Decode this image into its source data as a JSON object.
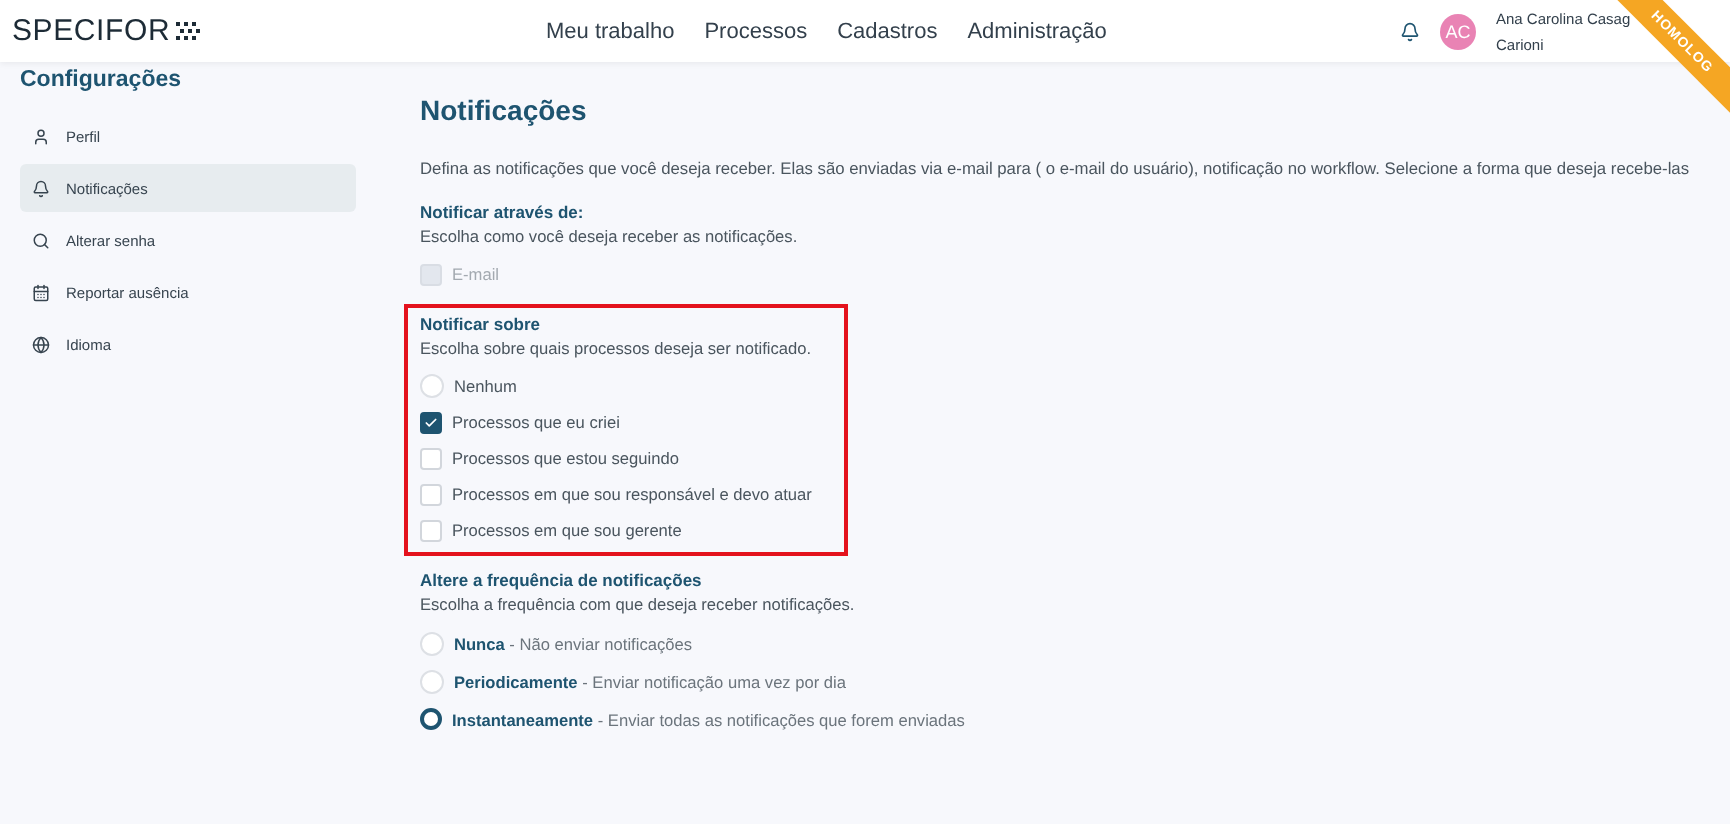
{
  "header": {
    "logo": "SPECIFOR",
    "nav": [
      "Meu trabalho",
      "Processos",
      "Cadastros",
      "Administração"
    ],
    "user": {
      "initials": "AC",
      "name_line1": "Ana Carolina Casag",
      "name_line2": "Carioni"
    },
    "ribbon": "HOMOLOG"
  },
  "sidebar": {
    "title": "Configurações",
    "items": [
      {
        "label": "Perfil",
        "selected": false
      },
      {
        "label": "Notificações",
        "selected": true
      },
      {
        "label": "Alterar senha",
        "selected": false
      },
      {
        "label": "Reportar ausência",
        "selected": false
      },
      {
        "label": "Idioma",
        "selected": false
      }
    ]
  },
  "page": {
    "title": "Notificações",
    "description": "Defina as notificações que você deseja receber. Elas são enviadas via e-mail para ( o e-mail do usuário), notificação no workflow. Selecione a forma que deseja recebe-las",
    "sections": [
      {
        "title": "Notificar através de:",
        "subtitle": "Escolha como você deseja receber as notificações.",
        "highlighted": false,
        "options": [
          {
            "kind": "checkbox",
            "label": "E-mail",
            "checked": false,
            "disabled": true
          }
        ]
      },
      {
        "title": "Notificar sobre",
        "subtitle": "Escolha sobre quais processos deseja ser notificado.",
        "highlighted": true,
        "options": [
          {
            "kind": "radio",
            "label": "Nenhum",
            "checked": false
          },
          {
            "kind": "checkbox",
            "label": "Processos que eu criei",
            "checked": true
          },
          {
            "kind": "checkbox",
            "label": "Processos que estou seguindo",
            "checked": false
          },
          {
            "kind": "checkbox",
            "label": "Processos em que sou responsável e devo atuar",
            "checked": false
          },
          {
            "kind": "checkbox",
            "label": "Processos em que sou gerente",
            "checked": false
          }
        ]
      },
      {
        "title": "Altere a frequência de notificações",
        "subtitle": "Escolha a frequência com que deseja receber notificações.",
        "highlighted": false,
        "options": [
          {
            "kind": "radio",
            "label": "Nunca",
            "detail": "- Não enviar notificações",
            "checked": false
          },
          {
            "kind": "radio",
            "label": "Periodicamente",
            "detail": "- Enviar notificação uma vez por dia",
            "checked": false
          },
          {
            "kind": "radio",
            "label": "Instantaneamente",
            "detail": "- Enviar todas as notificações que forem enviadas",
            "checked": true
          }
        ]
      }
    ]
  }
}
